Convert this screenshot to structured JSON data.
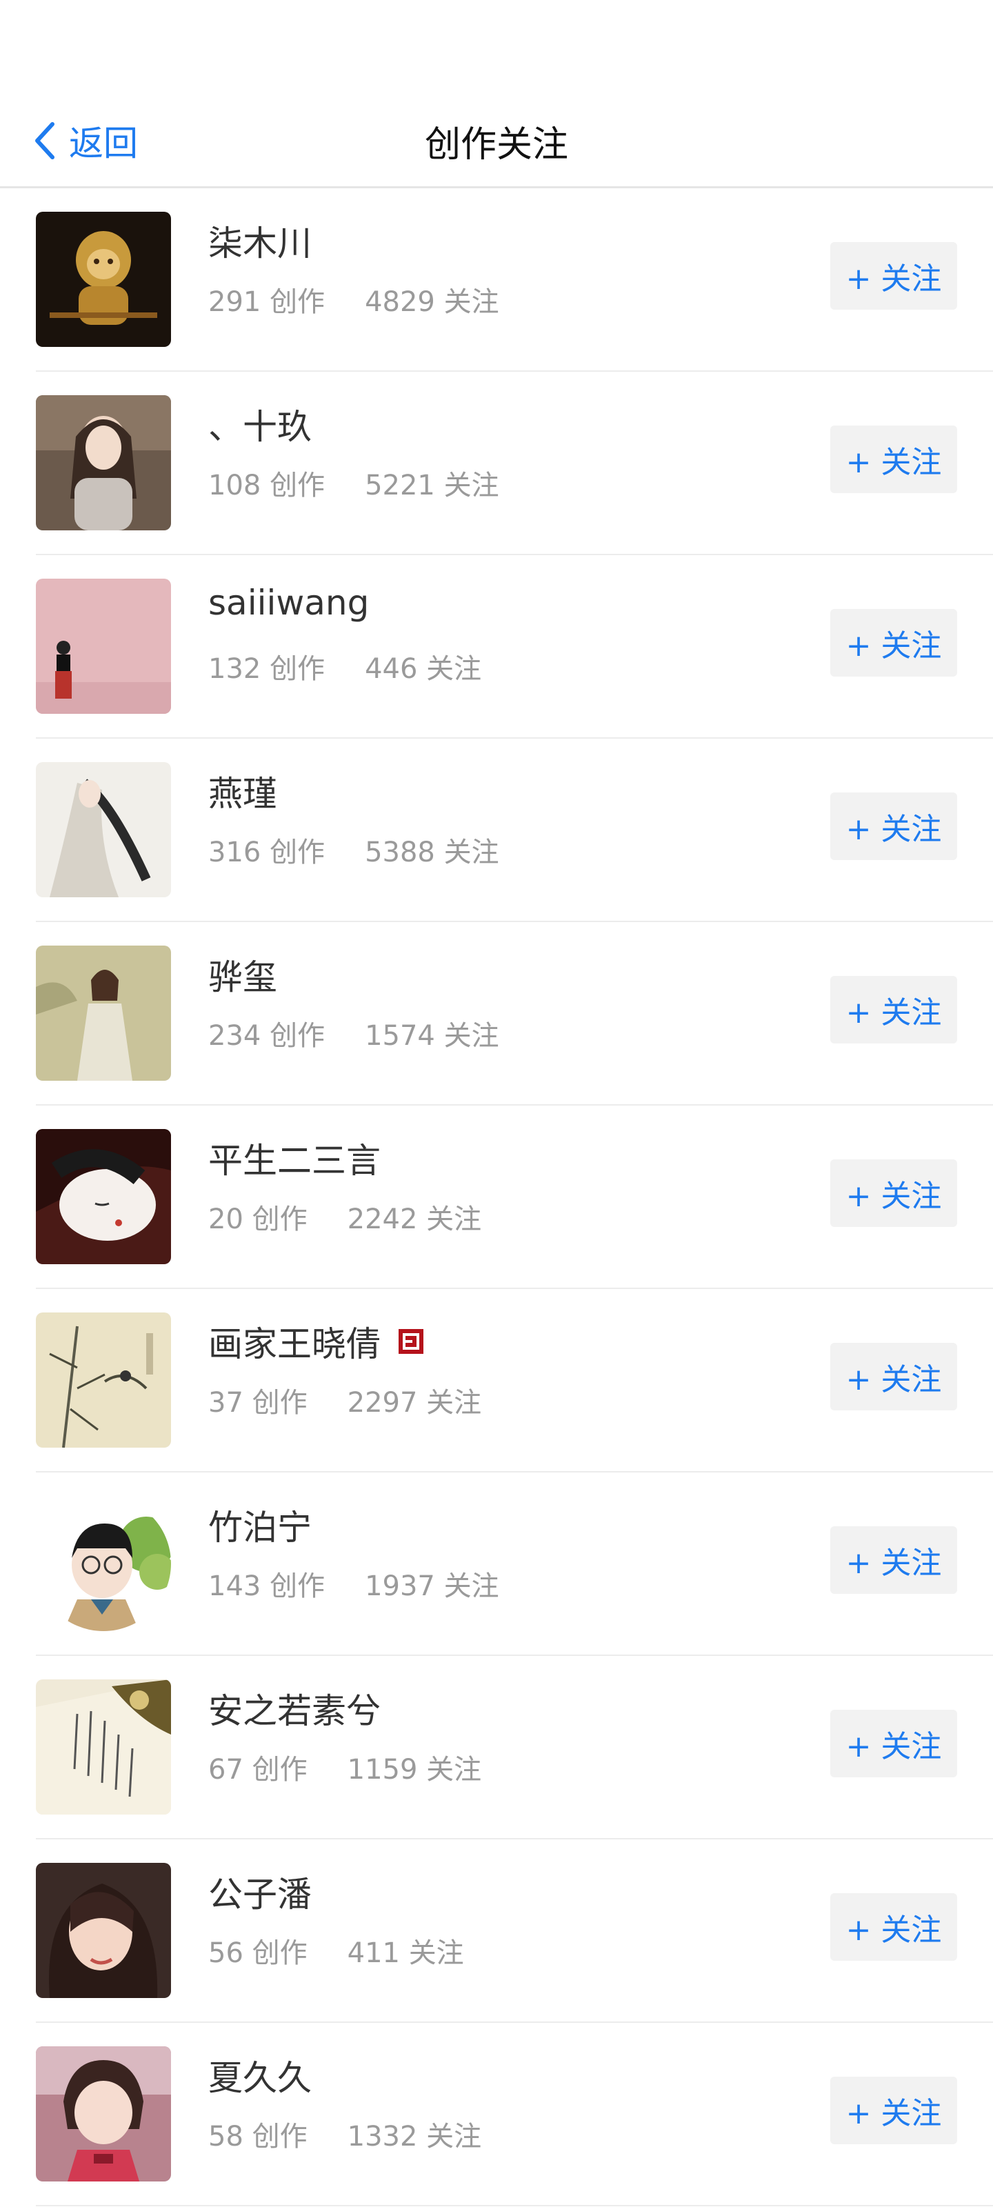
{
  "header": {
    "back_label": "返回",
    "title": "创作关注"
  },
  "colors": {
    "accent": "#1e7bef",
    "muted_text": "#9a9a9a",
    "button_bg": "#f2f2f2",
    "badge_red": "#b5121b"
  },
  "follow_label": "+ 关注",
  "users": [
    {
      "name": "柒木川",
      "creations": "291 创作",
      "follows": "4829 关注"
    },
    {
      "name": "、十玖",
      "creations": "108 创作",
      "follows": "5221 关注"
    },
    {
      "name": "saiiiwang",
      "creations": "132 创作",
      "follows": "446 关注"
    },
    {
      "name": "燕瑾",
      "creations": "316 创作",
      "follows": "5388 关注"
    },
    {
      "name": "骅玺",
      "creations": "234 创作",
      "follows": "1574 关注"
    },
    {
      "name": "平生二三言",
      "creations": "20 创作",
      "follows": "2242 关注"
    },
    {
      "name": "画家王晓倩",
      "creations": "37 创作",
      "follows": "2297 关注",
      "verified_icon": "seal-badge-icon"
    },
    {
      "name": "竹泊宁",
      "creations": "143 创作",
      "follows": "1937 关注"
    },
    {
      "name": "安之若素兮",
      "creations": "67 创作",
      "follows": "1159 关注"
    },
    {
      "name": "公子潘",
      "creations": "56 创作",
      "follows": "411 关注"
    },
    {
      "name": "夏久久",
      "creations": "58 创作",
      "follows": "1332 关注"
    }
  ]
}
